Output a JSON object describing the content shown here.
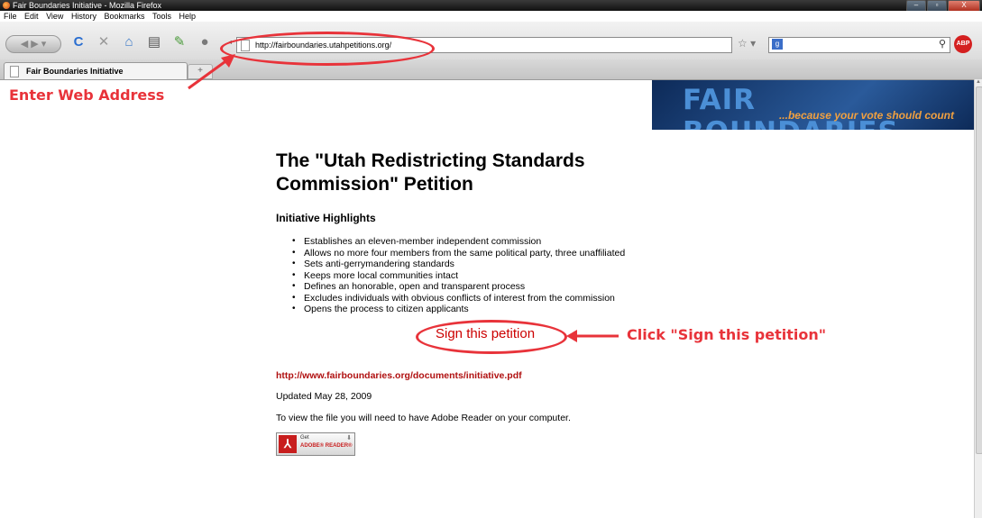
{
  "window": {
    "title": "Fair Boundaries Initiative - Mozilla Firefox",
    "controls": [
      "–",
      "▫",
      "X"
    ]
  },
  "menu": [
    "File",
    "Edit",
    "View",
    "History",
    "Bookmarks",
    "Tools",
    "Help"
  ],
  "toolbar": {
    "url": "http://fairboundaries.utahpetitions.org/",
    "search_placeholder": "",
    "abp_label": "ABP",
    "icons": [
      "back-forward-icon",
      "reload-icon",
      "stop-icon",
      "home-icon",
      "print-icon",
      "bookmark-icon",
      "addon-icon",
      "star-icon",
      "google-icon",
      "search-icon",
      "adblock-icon"
    ]
  },
  "tabs": [
    {
      "label": "Fair Boundaries Initiative"
    }
  ],
  "newtab_label": "+",
  "banner": {
    "title": "FAIR BOUNDARIES",
    "tagline": "...because your vote should count"
  },
  "content": {
    "heading": "The \"Utah Redistricting Standards Commission\" Petition",
    "subheading": "Initiative Highlights",
    "highlights": [
      "Establishes an eleven-member independent commission",
      "Allows no more four members from the same political party, three unaffiliated",
      "Sets anti-gerrymandering standards",
      "Keeps more local communities intact",
      "Defines an honorable, open and transparent process",
      "Excludes individuals with obvious conflicts of interest from the commission",
      "Opens the process to citizen applicants"
    ],
    "sign_link": "Sign this petition",
    "pdf_link": "http://www.fairboundaries.org/documents/initiative.pdf",
    "updated": "Updated May 28, 2009",
    "reader_note": "To view the file you will need to have Adobe Reader on your computer.",
    "adobe_badge": {
      "get": "Get",
      "reader": "ADOBE® READER®"
    }
  },
  "annotations": {
    "enter_address": "Enter Web Address",
    "click_sign": "Click \"Sign this petition\"",
    "color": "#e8333a"
  }
}
